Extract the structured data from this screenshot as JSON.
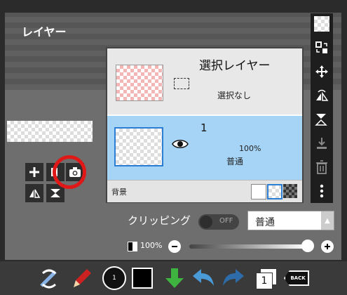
{
  "panel": {
    "title": "レイヤー"
  },
  "layers_list": {
    "selection": {
      "name": "選択レイヤー",
      "status": "選択なし"
    },
    "layer1": {
      "name": "1",
      "opacity": "100%",
      "blend": "普通"
    },
    "background": {
      "label": "背景"
    }
  },
  "clipping": {
    "label": "クリッピング",
    "toggle_state": "OFF"
  },
  "blend_mode": {
    "value": "普通"
  },
  "opacity": {
    "value": "100%",
    "fraction": 1.0
  },
  "toolbar": {
    "layer_count": "1",
    "back_label": "BACK",
    "brush_size": "1"
  },
  "colors": {
    "accent_blue": "#2a7fd4",
    "selected_row": "#a6d4f6",
    "annotation_red": "#e01818"
  },
  "icons": [
    "plus-icon",
    "layer-add-icon",
    "camera-icon",
    "flip-icon",
    "merge-down-icon",
    "transparency-icon",
    "transform-icon",
    "move-icon",
    "flip-horizontal-icon",
    "flip-vertical-icon",
    "merge-icon",
    "trash-icon",
    "more-icon",
    "tools-icon",
    "pen-icon",
    "brush-size-icon",
    "color-swatch",
    "save-icon",
    "undo-icon",
    "redo-icon",
    "layers-icon",
    "back-icon"
  ]
}
